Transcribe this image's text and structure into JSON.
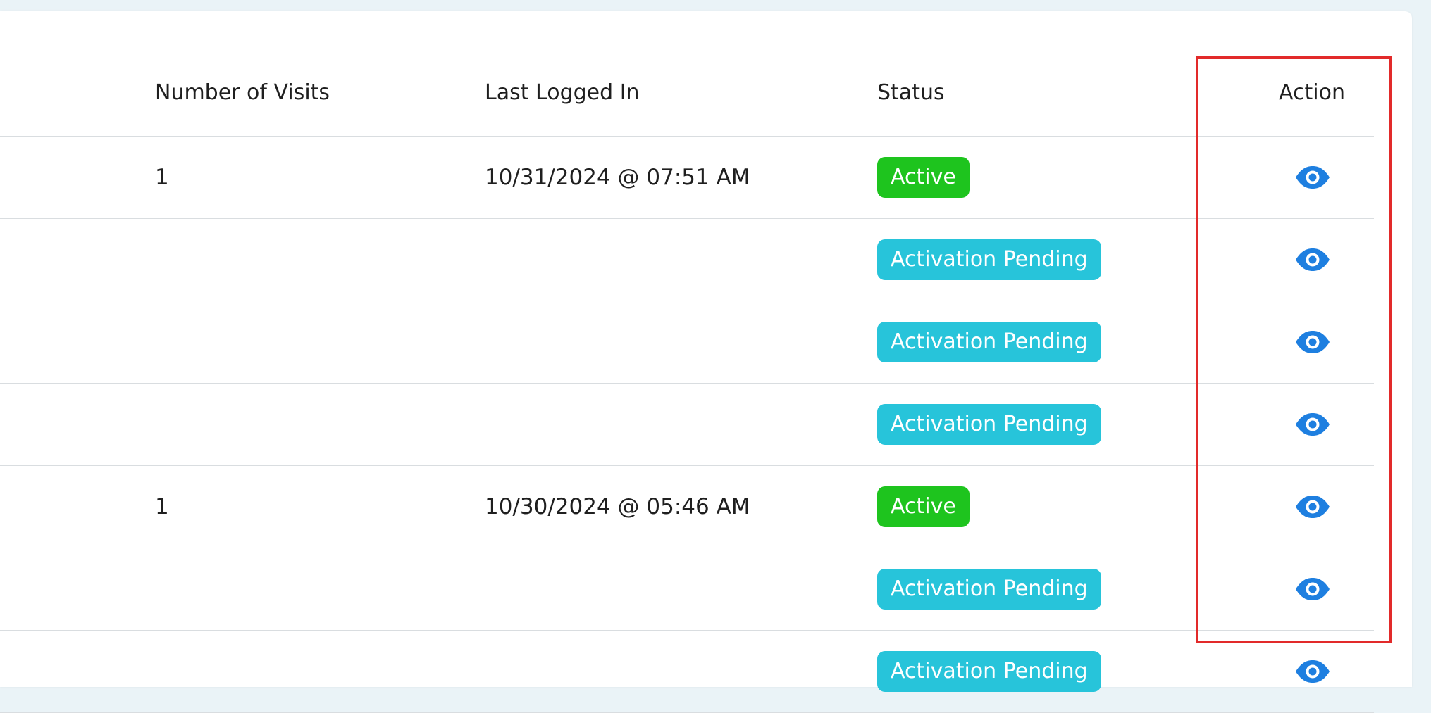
{
  "table": {
    "headers": {
      "visits": "Number of Visits",
      "last_logged_in": "Last Logged In",
      "status": "Status",
      "action": "Action"
    },
    "rows": [
      {
        "visits": "1",
        "last_logged_in": "10/31/2024 @ 07:51 AM",
        "status": "Active",
        "status_type": "active"
      },
      {
        "visits": "",
        "last_logged_in": "",
        "status": "Activation Pending",
        "status_type": "pending"
      },
      {
        "visits": "",
        "last_logged_in": "",
        "status": "Activation Pending",
        "status_type": "pending"
      },
      {
        "visits": "",
        "last_logged_in": "",
        "status": "Activation Pending",
        "status_type": "pending"
      },
      {
        "visits": "1",
        "last_logged_in": "10/30/2024 @ 05:46 AM",
        "status": "Active",
        "status_type": "active"
      },
      {
        "visits": "",
        "last_logged_in": "",
        "status": "Activation Pending",
        "status_type": "pending"
      },
      {
        "visits": "",
        "last_logged_in": "",
        "status": "Activation Pending",
        "status_type": "pending"
      }
    ]
  },
  "colors": {
    "active_badge": "#1ec41e",
    "pending_badge": "#27c4da",
    "eye_icon": "#1e7fe0",
    "highlight_border": "#e22a2a"
  },
  "icons": {
    "action": "eye-icon"
  }
}
